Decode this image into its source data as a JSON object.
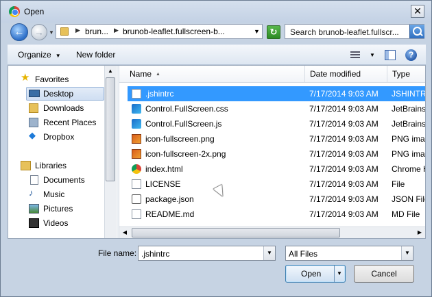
{
  "window": {
    "title": "Open",
    "close_label": "✕"
  },
  "address_bar": {
    "crumbs": [
      "brun...",
      "brunob-leaflet.fullscreen-b..."
    ],
    "search_placeholder": "Search brunob-leaflet.fullscr..."
  },
  "toolbar": {
    "organize_label": "Organize",
    "new_folder_label": "New folder",
    "help_label": "?"
  },
  "nav_pane": {
    "items": [
      {
        "label": "Favorites",
        "icon": "star-icon"
      },
      {
        "label": "Desktop",
        "icon": "desktop-icon"
      },
      {
        "label": "Downloads",
        "icon": "downloads-icon"
      },
      {
        "label": "Recent Places",
        "icon": "recent-places-icon"
      },
      {
        "label": "Dropbox",
        "icon": "dropbox-icon"
      },
      {
        "label": "Libraries",
        "icon": "libraries-icon"
      },
      {
        "label": "Documents",
        "icon": "documents-icon"
      },
      {
        "label": "Music",
        "icon": "music-icon"
      },
      {
        "label": "Pictures",
        "icon": "pictures-icon"
      },
      {
        "label": "Videos",
        "icon": "videos-icon"
      }
    ]
  },
  "file_list": {
    "columns": [
      "Name",
      "Date modified",
      "Type"
    ],
    "rows": [
      {
        "name": ".jshintrc",
        "date": "7/17/2014 9:03 AM",
        "type": "JSHINTRC",
        "icon": "document-icon"
      },
      {
        "name": "Control.FullScreen.css",
        "date": "7/17/2014 9:03 AM",
        "type": "JetBrains W",
        "icon": "webstorm-icon"
      },
      {
        "name": "Control.FullScreen.js",
        "date": "7/17/2014 9:03 AM",
        "type": "JetBrains W",
        "icon": "webstorm-icon"
      },
      {
        "name": "icon-fullscreen.png",
        "date": "7/17/2014 9:03 AM",
        "type": "PNG image",
        "icon": "png-icon"
      },
      {
        "name": "icon-fullscreen-2x.png",
        "date": "7/17/2014 9:03 AM",
        "type": "PNG image",
        "icon": "png-icon"
      },
      {
        "name": "index.html",
        "date": "7/17/2014 9:03 AM",
        "type": "Chrome H",
        "icon": "chrome-icon"
      },
      {
        "name": "LICENSE",
        "date": "7/17/2014 9:03 AM",
        "type": "File",
        "icon": "document-icon"
      },
      {
        "name": "package.json",
        "date": "7/17/2014 9:03 AM",
        "type": "JSON File",
        "icon": "json-icon"
      },
      {
        "name": "README.md",
        "date": "7/17/2014 9:03 AM",
        "type": "MD File",
        "icon": "document-icon"
      }
    ],
    "selected_index": 0
  },
  "bottom": {
    "file_name_label": "File name:",
    "file_name_value": ".jshintrc",
    "filter_value": "All Files",
    "open_label": "Open",
    "cancel_label": "Cancel"
  }
}
